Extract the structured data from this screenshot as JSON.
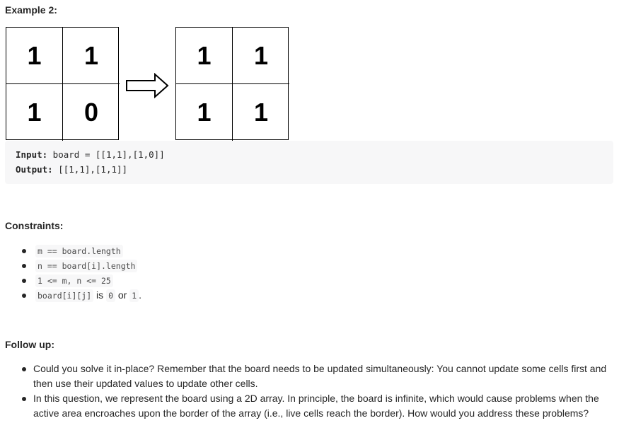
{
  "example_heading": "Example 2:",
  "input_board": [
    [
      "1",
      "1"
    ],
    [
      "1",
      "0"
    ]
  ],
  "output_board": [
    [
      "1",
      "1"
    ],
    [
      "1",
      "1"
    ]
  ],
  "example": {
    "input_label": "Input:",
    "input_value": " board = [[1,1],[1,0]]",
    "output_label": "Output:",
    "output_value": " [[1,1],[1,1]]"
  },
  "constraints_heading": "Constraints:",
  "constraints": {
    "c1_code": "m == board.length",
    "c2_code": "n == board[i].length",
    "c3_code": "1 <= m, n <= 25",
    "c4_code_a": "board[i][j]",
    "c4_text_a": " is ",
    "c4_code_b": "0",
    "c4_text_b": " or ",
    "c4_code_c": "1",
    "c4_text_c": "."
  },
  "follow_up_heading": "Follow up:",
  "follow_up": [
    "Could you solve it in-place? Remember that the board needs to be updated simultaneously: You cannot update some cells first and then use their updated values to update other cells.",
    "In this question, we represent the board using a 2D array. In principle, the board is infinite, which would cause problems when the active area encroaches upon the border of the array (i.e., live cells reach the border). How would you address these problems?"
  ]
}
